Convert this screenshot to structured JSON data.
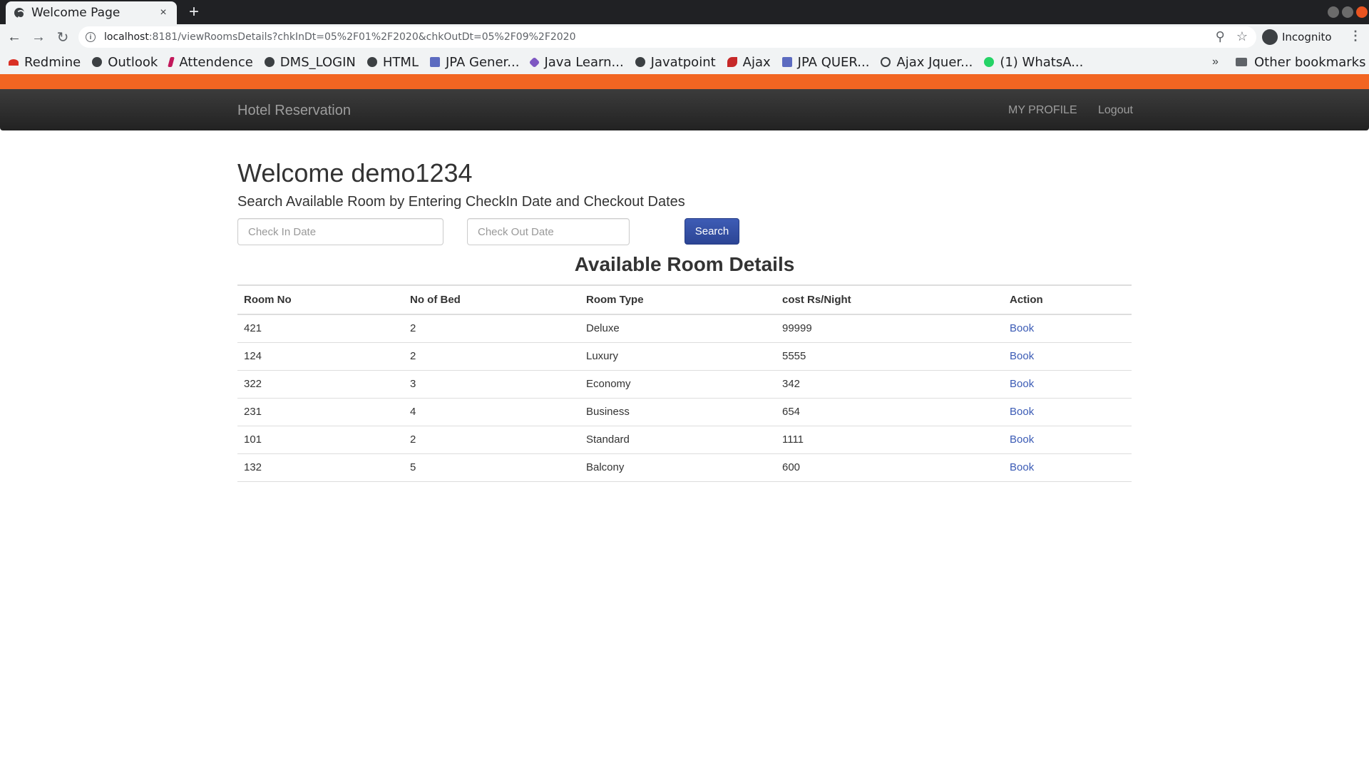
{
  "browser": {
    "tab_title": "Welcome Page",
    "tab_close": "×",
    "new_tab": "+",
    "url_host": "localhost",
    "url_rest": ":8181/viewRoomsDetails?chkInDt=05%2F01%2F2020&chkOutDt=05%2F09%2F2020",
    "incognito_label": "Incognito",
    "bookmarks": [
      {
        "label": "Redmine",
        "icon": "redmine-icon"
      },
      {
        "label": "Outlook",
        "icon": "globe-icon"
      },
      {
        "label": "Attendence",
        "icon": "attendence-icon"
      },
      {
        "label": "DMS_LOGIN",
        "icon": "globe-icon"
      },
      {
        "label": "HTML",
        "icon": "globe-icon"
      },
      {
        "label": "JPA Gener...",
        "icon": "jpa-icon"
      },
      {
        "label": "Java Learn...",
        "icon": "java-icon"
      },
      {
        "label": "Javatpoint",
        "icon": "globe-icon"
      },
      {
        "label": "Ajax",
        "icon": "ajax-icon"
      },
      {
        "label": "JPA QUER...",
        "icon": "jpa-icon"
      },
      {
        "label": "Ajax Jquer...",
        "icon": "ring-icon"
      },
      {
        "label": "(1) WhatsA...",
        "icon": "whatsapp-icon"
      }
    ],
    "bookmarks_more": "»",
    "other_bookmarks": "Other bookmarks"
  },
  "navbar": {
    "brand": "Hotel Reservation",
    "profile": "MY PROFILE",
    "logout": "Logout"
  },
  "main": {
    "welcome": "Welcome demo1234",
    "subtitle": "Search Available Room by Entering CheckIn Date and Checkout Dates",
    "checkin_placeholder": "Check In Date",
    "checkout_placeholder": "Check Out Date",
    "search_label": "Search",
    "table_title": "Available Room Details"
  },
  "table": {
    "headers": [
      "Room No",
      "No of Bed",
      "Room Type",
      "cost Rs/Night",
      "Action"
    ],
    "rows": [
      [
        "421",
        "2",
        "Deluxe",
        "99999",
        "Book"
      ],
      [
        "124",
        "2",
        "Luxury",
        "5555",
        "Book"
      ],
      [
        "322",
        "3",
        "Economy",
        "342",
        "Book"
      ],
      [
        "231",
        "4",
        "Business",
        "654",
        "Book"
      ],
      [
        "101",
        "2",
        "Standard",
        "1111",
        "Book"
      ],
      [
        "132",
        "5",
        "Balcony",
        "600",
        "Book"
      ]
    ]
  },
  "colors": {
    "accent_orange": "#f26522",
    "navbar_dark": "#222222",
    "button_blue": "#2c4595",
    "link_blue": "#3b5bb5"
  }
}
